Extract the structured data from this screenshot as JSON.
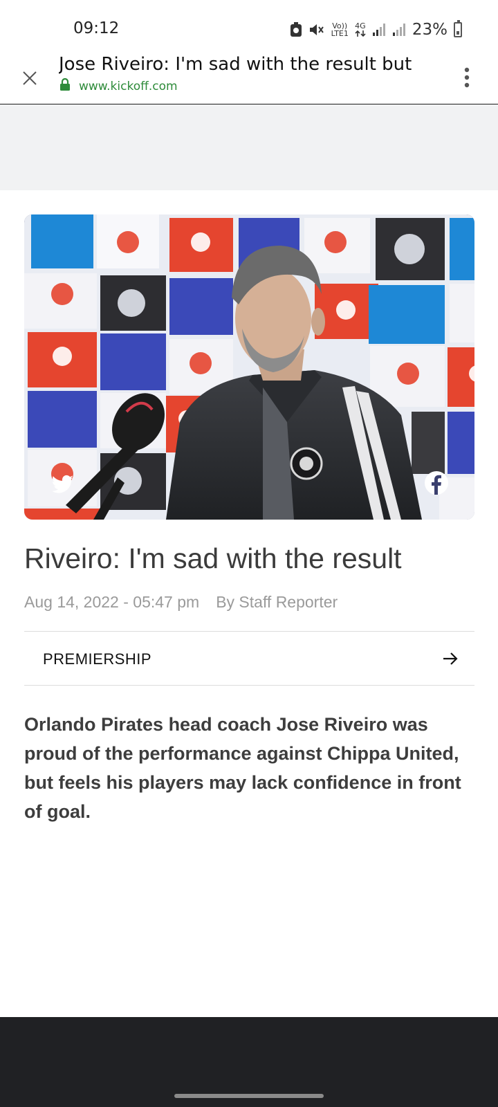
{
  "status_bar": {
    "time": "09:12",
    "network_label_top": "Vo))",
    "network_label_bottom": "LTE1",
    "network_type": "4G",
    "battery_percent": "23%",
    "icons": [
      "screenshot-saver-icon",
      "mute-icon",
      "volte-icon",
      "data-arrows-icon",
      "signal-icon",
      "signal-icon",
      "battery-icon"
    ]
  },
  "toolbar": {
    "page_title": "Jose Riveiro: I'm sad with the result but",
    "url": "www.kickoff.com",
    "icons": [
      "close-icon",
      "lock-icon",
      "more-vert-icon"
    ]
  },
  "article": {
    "hero_image_alt": "Jose Riveiro at a press conference",
    "share": [
      "twitter-icon",
      "facebook-icon"
    ],
    "title": "Riveiro: I'm sad with the result",
    "date": "Aug 14, 2022 - 05:47 pm",
    "author": "By Staff Reporter",
    "category": "PREMIERSHIP",
    "lede": "Orlando Pirates head coach Jose Riveiro was proud of the performance against Chippa United, but feels his players may lack confidence in front of goal."
  },
  "colors": {
    "url_green": "#2e8b3a",
    "title_text": "#3b3b3b",
    "meta_text": "#9a9a9a",
    "bottom_bar": "#202124"
  }
}
